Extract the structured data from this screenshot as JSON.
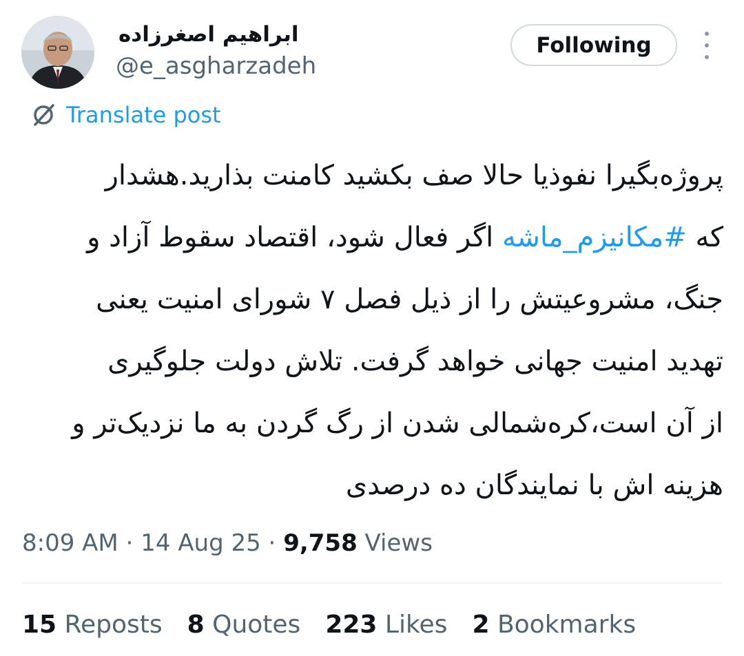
{
  "author": {
    "display_name": "ابراهیم اصغرزاده",
    "handle": "@e_asgharzadeh"
  },
  "follow_button": "Following",
  "translate_label": "Translate post",
  "post": {
    "line1": "پروژه‌بگیرا نفوذیا حالا صف بکشید کامنت بذارید.هشدار",
    "line2_prefix": "که ",
    "hashtag": "#مکانیزم_ماشه",
    "line2_suffix": " اگر فعال شود، اقتصاد سقوط آزاد و",
    "line3": "جنگ، مشروعیتش را از ذیل فصل ۷ شورای امنیت یعنی",
    "line4": "تهدید امنیت جهانی خواهد گرفت. تلاش دولت جلوگیری",
    "line5": "از آن است،کره‌شمالی شدن از رگ گردن به ما نزدیک‌تر و",
    "line6": "هزینه اش با نمایندگان ده درصدی"
  },
  "meta": {
    "time": "8:09 AM",
    "separator": " · ",
    "date": "14 Aug 25",
    "views_count": "9,758",
    "views_label": " Views"
  },
  "stats": {
    "reposts_count": "15",
    "reposts_label": " Reposts",
    "quotes_count": "8",
    "quotes_label": " Quotes",
    "likes_count": "223",
    "likes_label": " Likes",
    "bookmarks_count": "2",
    "bookmarks_label": " Bookmarks"
  },
  "colors": {
    "link": "#1d9bf0",
    "text": "#0f1419",
    "secondary": "#536471",
    "border": "#cfd9de"
  }
}
